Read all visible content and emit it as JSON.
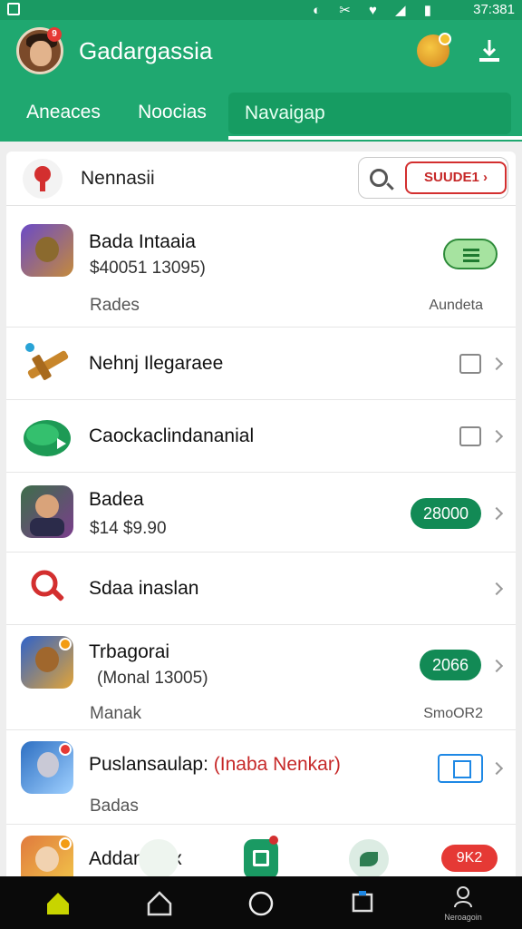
{
  "status_bar": {
    "time": "37:381",
    "icons": "◐ ✂ ♥ ◢ ▮"
  },
  "app": {
    "title": "Gadargassia",
    "avatar_badge": "9"
  },
  "tabs": [
    {
      "label": "Aneaces"
    },
    {
      "label": "Noocias"
    },
    {
      "label": "Navaigap",
      "active": true
    }
  ],
  "search": {
    "title": "Nennasii",
    "button_label": "SUUDE1 ›"
  },
  "list": [
    {
      "name": "Bada Intaaia",
      "sub": "$40051 13095)",
      "meta_left": "Rades",
      "meta_right": "Aundeta",
      "action": "list-toggle"
    },
    {
      "name": "Nehnj Ilegaraee",
      "action": "checkbox"
    },
    {
      "name": "Caockaclindananial",
      "action": "checkbox"
    },
    {
      "name": "Badea",
      "sub": "$14 $9.90",
      "pill": "28000"
    },
    {
      "name": "Sdaa inaslan"
    },
    {
      "name": "Trbagorai",
      "sub": "(Monal 13005)",
      "meta_left": "Manak",
      "meta_right": "SmoOR2",
      "pill": "2066"
    },
    {
      "name": "Puslansaulap:",
      "name_extra": "(Inaba Nenkar)",
      "meta_left": "Badas",
      "action": "external"
    },
    {
      "name": "Addankilox",
      "red_pill": "9K2"
    }
  ],
  "nav": {
    "profile_label": "Neroagoin"
  },
  "colors": {
    "primary": "#1fa870",
    "primary_dark": "#128a55",
    "accent_red": "#d32f2f",
    "link_blue": "#1e88e5"
  }
}
